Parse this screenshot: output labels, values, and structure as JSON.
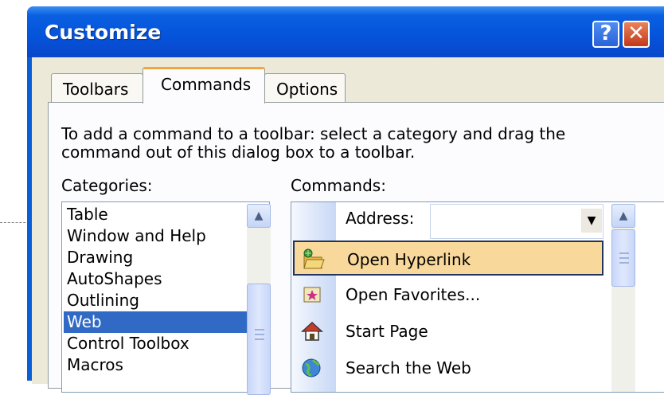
{
  "window": {
    "title": "Customize",
    "help_glyph": "?",
    "close_glyph": "✕"
  },
  "tabs": [
    {
      "label": "Toolbars",
      "active": false
    },
    {
      "label": "Commands",
      "active": true
    },
    {
      "label": "Options",
      "active": false
    }
  ],
  "instruction": "To add a command to a toolbar: select a category and drag the command out of this dialog box to a toolbar.",
  "categories": {
    "label": "Categories:",
    "items": [
      "Table",
      "Window and Help",
      "Drawing",
      "AutoShapes",
      "Outlining",
      "Web",
      "Control Toolbox",
      "Macros"
    ],
    "selected": "Web"
  },
  "commands": {
    "label": "Commands:",
    "address": {
      "label": "Address:",
      "value": ""
    },
    "items": [
      {
        "label": "Open Hyperlink",
        "icon": "open-hyperlink-icon",
        "highlighted": true
      },
      {
        "label": "Open Favorites...",
        "icon": "favorites-icon",
        "highlighted": false
      },
      {
        "label": "Start Page",
        "icon": "home-icon",
        "highlighted": false
      },
      {
        "label": "Search the Web",
        "icon": "globe-search-icon",
        "highlighted": false
      }
    ]
  },
  "colors": {
    "titlebar": "#0553da",
    "selection": "#316ac5",
    "hover_highlight": "#f9d99b",
    "active_tab_accent": "#f3a73a"
  }
}
